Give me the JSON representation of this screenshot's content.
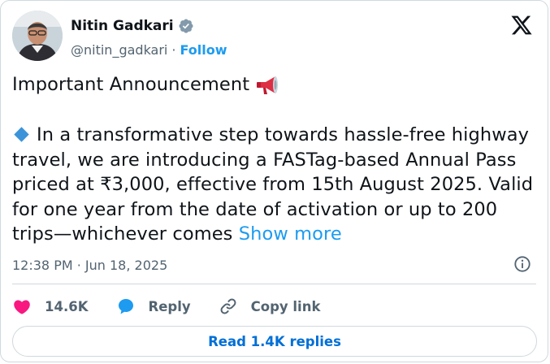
{
  "user": {
    "name": "Nitin Gadkari",
    "handle": "@nitin_gadkari",
    "separator": "·",
    "follow_label": "Follow"
  },
  "tweet": {
    "heading": "Important Announcement",
    "body": "In a transformative step towards hassle-free highway travel, we are introducing a FASTag-based Annual Pass priced at ₹3,000, effective from 15th August 2025. Valid for one year from the date of activation or up to 200 trips—whichever comes",
    "show_more": "Show more"
  },
  "meta": {
    "timestamp": "12:38 PM · Jun 18, 2025"
  },
  "actions": {
    "likes": "14.6K",
    "reply_label": "Reply",
    "copy_link_label": "Copy link"
  },
  "read_replies_label": "Read 1.4K replies",
  "colors": {
    "accent": "#1d9bf0",
    "like": "#f91880",
    "verified": "#829aab",
    "text": "#0f1419",
    "muted": "#536471"
  }
}
